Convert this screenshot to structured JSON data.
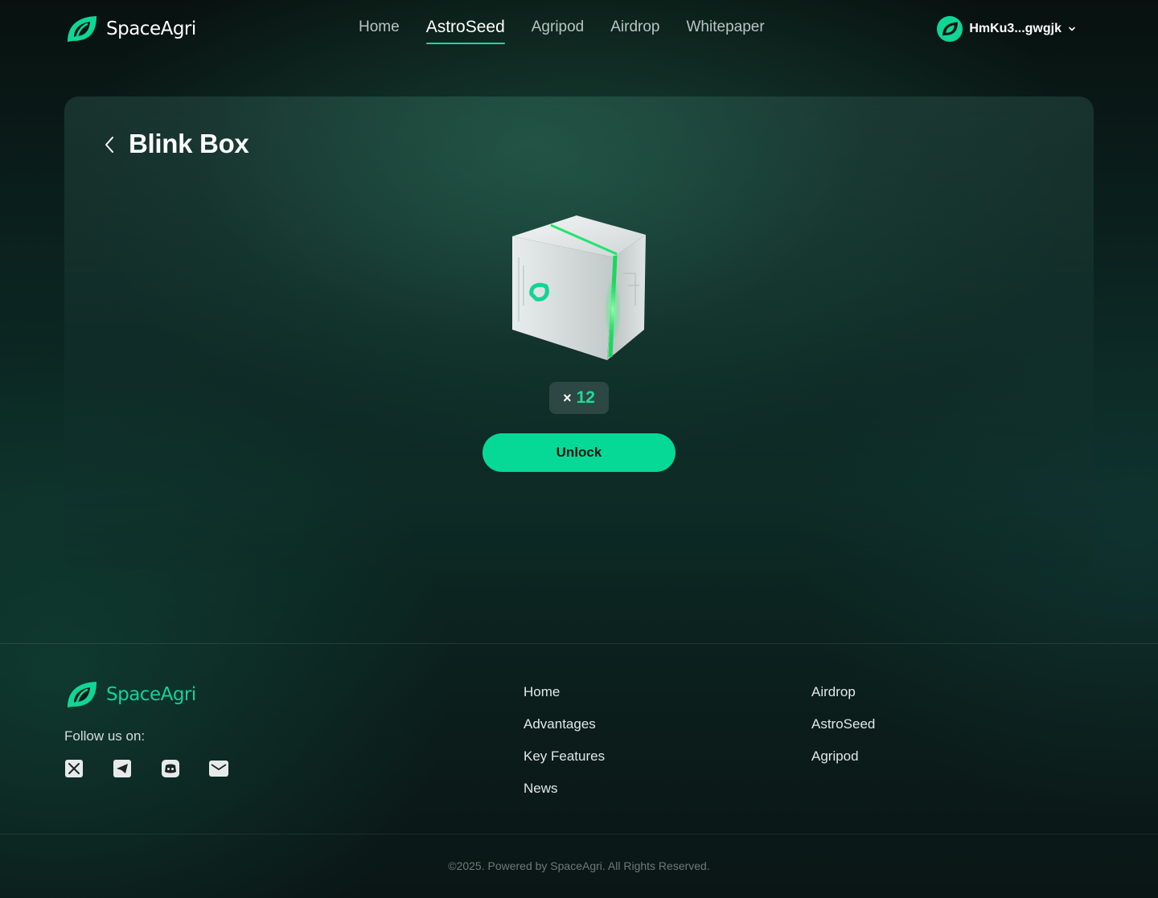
{
  "brand": {
    "name": "SpaceAgri",
    "color": "#0fd694"
  },
  "nav": {
    "items": [
      {
        "label": "Home",
        "active": false
      },
      {
        "label": "AstroSeed",
        "active": true
      },
      {
        "label": "Agripod",
        "active": false
      },
      {
        "label": "Airdrop",
        "active": false
      },
      {
        "label": "Whitepaper",
        "active": false
      }
    ]
  },
  "account": {
    "label": "HmKu3...gwgjk",
    "icon": "chevron-down-icon"
  },
  "card": {
    "title": "Blink Box",
    "back_icon": "chevron-left-icon",
    "count_prefix": "×",
    "count": "12",
    "unlock_label": "Unlock"
  },
  "footer": {
    "brand": "SpaceAgri",
    "follow_label": "Follow us on:",
    "socials": [
      "x-icon",
      "telegram-icon",
      "discord-icon",
      "email-icon"
    ],
    "col1": [
      "Home",
      "Advantages",
      "Key Features",
      "News"
    ],
    "col2": [
      "Airdrop",
      "AstroSeed",
      "Agripod"
    ],
    "copyright": "©2025. Powered by SpaceAgri. All Rights Reserved."
  }
}
